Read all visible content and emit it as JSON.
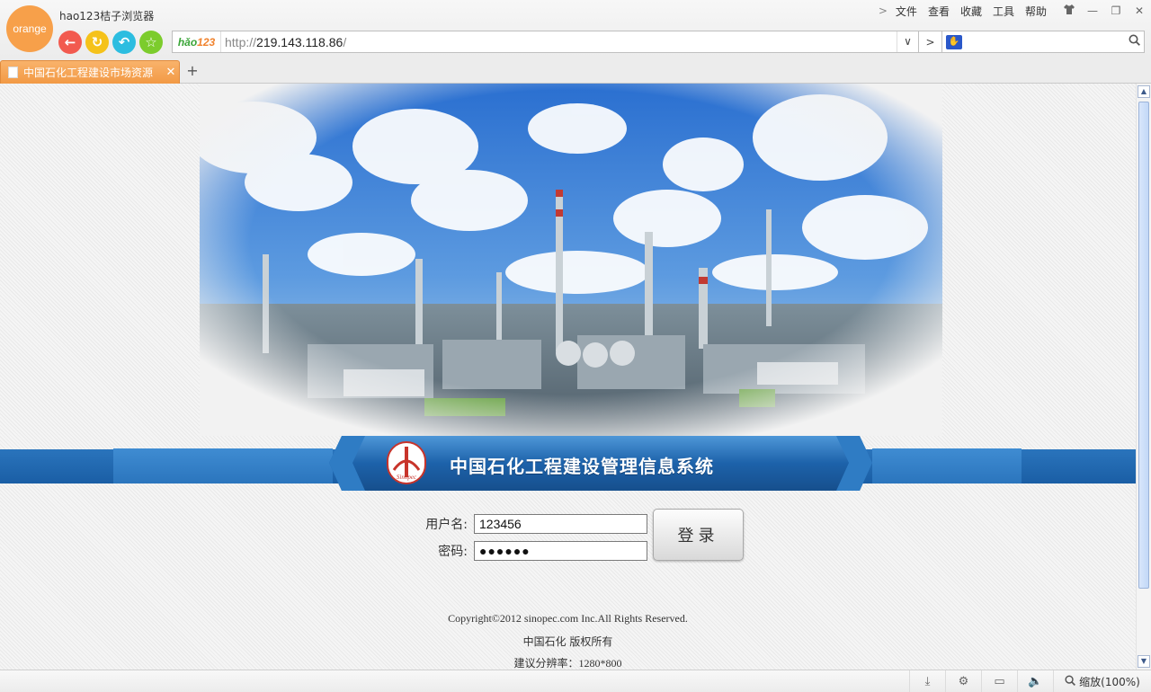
{
  "browser": {
    "logo_text": "orange",
    "app_title": "hao123桔子浏览器",
    "menu": [
      "文件",
      "查看",
      "收藏",
      "工具",
      "帮助"
    ],
    "address": {
      "badge_a": "hǎo",
      "badge_b": "123",
      "scheme": "http://",
      "host": "219.143.118.86",
      "path": "/"
    },
    "search": {
      "value": ""
    },
    "tab": {
      "title": "中国石化工程建设市场资源"
    },
    "status": {
      "zoom_label": "缩放(100%)"
    }
  },
  "page": {
    "banner_title": "中国石化工程建设管理信息系统",
    "login": {
      "username_label": "用户名:",
      "password_label": "密码:",
      "username_value": "123456",
      "password_value": "●●●●●●",
      "button_label": "登录"
    },
    "footer": {
      "copyright": "Copyright©2012 sinopec.com Inc.All Rights Reserved.",
      "owner": "中国石化 版权所有",
      "resolution": "建议分辨率：1280*800"
    }
  }
}
